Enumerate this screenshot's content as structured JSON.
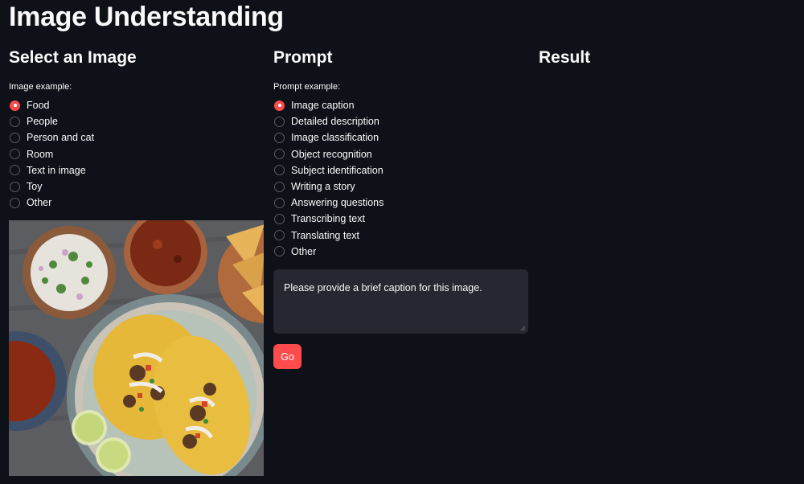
{
  "app": {
    "title": "Image Understanding"
  },
  "image_section": {
    "heading": "Select an Image",
    "radio_label": "Image example:",
    "selected": "Food",
    "options": [
      "Food",
      "People",
      "Person and cat",
      "Room",
      "Text in image",
      "Toy",
      "Other"
    ]
  },
  "prompt_section": {
    "heading": "Prompt",
    "radio_label": "Prompt example:",
    "selected": "Image caption",
    "options": [
      "Image caption",
      "Detailed description",
      "Image classification",
      "Object recognition",
      "Subject identification",
      "Writing a story",
      "Answering questions",
      "Transcribing text",
      "Translating text",
      "Other"
    ],
    "prompt_text": "Please provide a brief caption for this image.",
    "go_label": "Go"
  },
  "result_section": {
    "heading": "Result"
  },
  "colors": {
    "background": "#0e1117",
    "accent": "#ff4b4b",
    "input_bg": "#262730"
  }
}
